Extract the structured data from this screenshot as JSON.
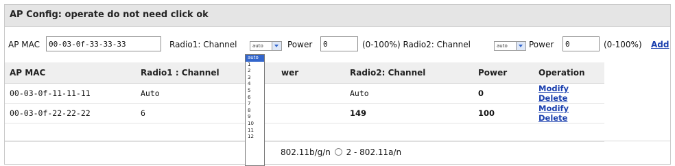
{
  "title": "AP Config: operate do not need click ok",
  "form": {
    "ap_mac_label": "AP MAC",
    "ap_mac_value": "00-03-0f-33-33-33",
    "radio1_channel_label": "Radio1: Channel",
    "radio1_channel_value": "auto",
    "power1_label": "Power",
    "power1_value": "0",
    "power1_hint": "(0-100%) Radio2: Channel",
    "radio2_channel_value": "auto",
    "power2_label": "Power",
    "power2_value": "0",
    "power2_hint": "(0-100%)",
    "add_label": "Add"
  },
  "table": {
    "headers": [
      "AP MAC",
      "Radio1 : Channel",
      "wer",
      "Radio2: Channel",
      "Power",
      "Operation"
    ],
    "rows": [
      {
        "mac": "00-03-0f-11-11-11",
        "r1": "Auto",
        "r2": "Auto",
        "power": "0",
        "modify": "Modify",
        "delete": "Delete"
      },
      {
        "mac": "00-03-0f-22-22-22",
        "r1": "6",
        "r2": "149",
        "power": "100",
        "modify": "Modify",
        "delete": "Delete"
      }
    ]
  },
  "bottom": {
    "radio_text_1": "802.11b/g/n",
    "radio_text_2": "2 - 802.11a/n"
  },
  "channel_dropdown": {
    "options": [
      "auto",
      "1",
      "2",
      "3",
      "4",
      "5",
      "6",
      "7",
      "8",
      "9",
      "10",
      "11",
      "12"
    ],
    "selected": "auto"
  },
  "colors": {
    "link": "#1a3fae",
    "title_bg": "#e5e5e5",
    "selected_option": "#3366cc"
  }
}
